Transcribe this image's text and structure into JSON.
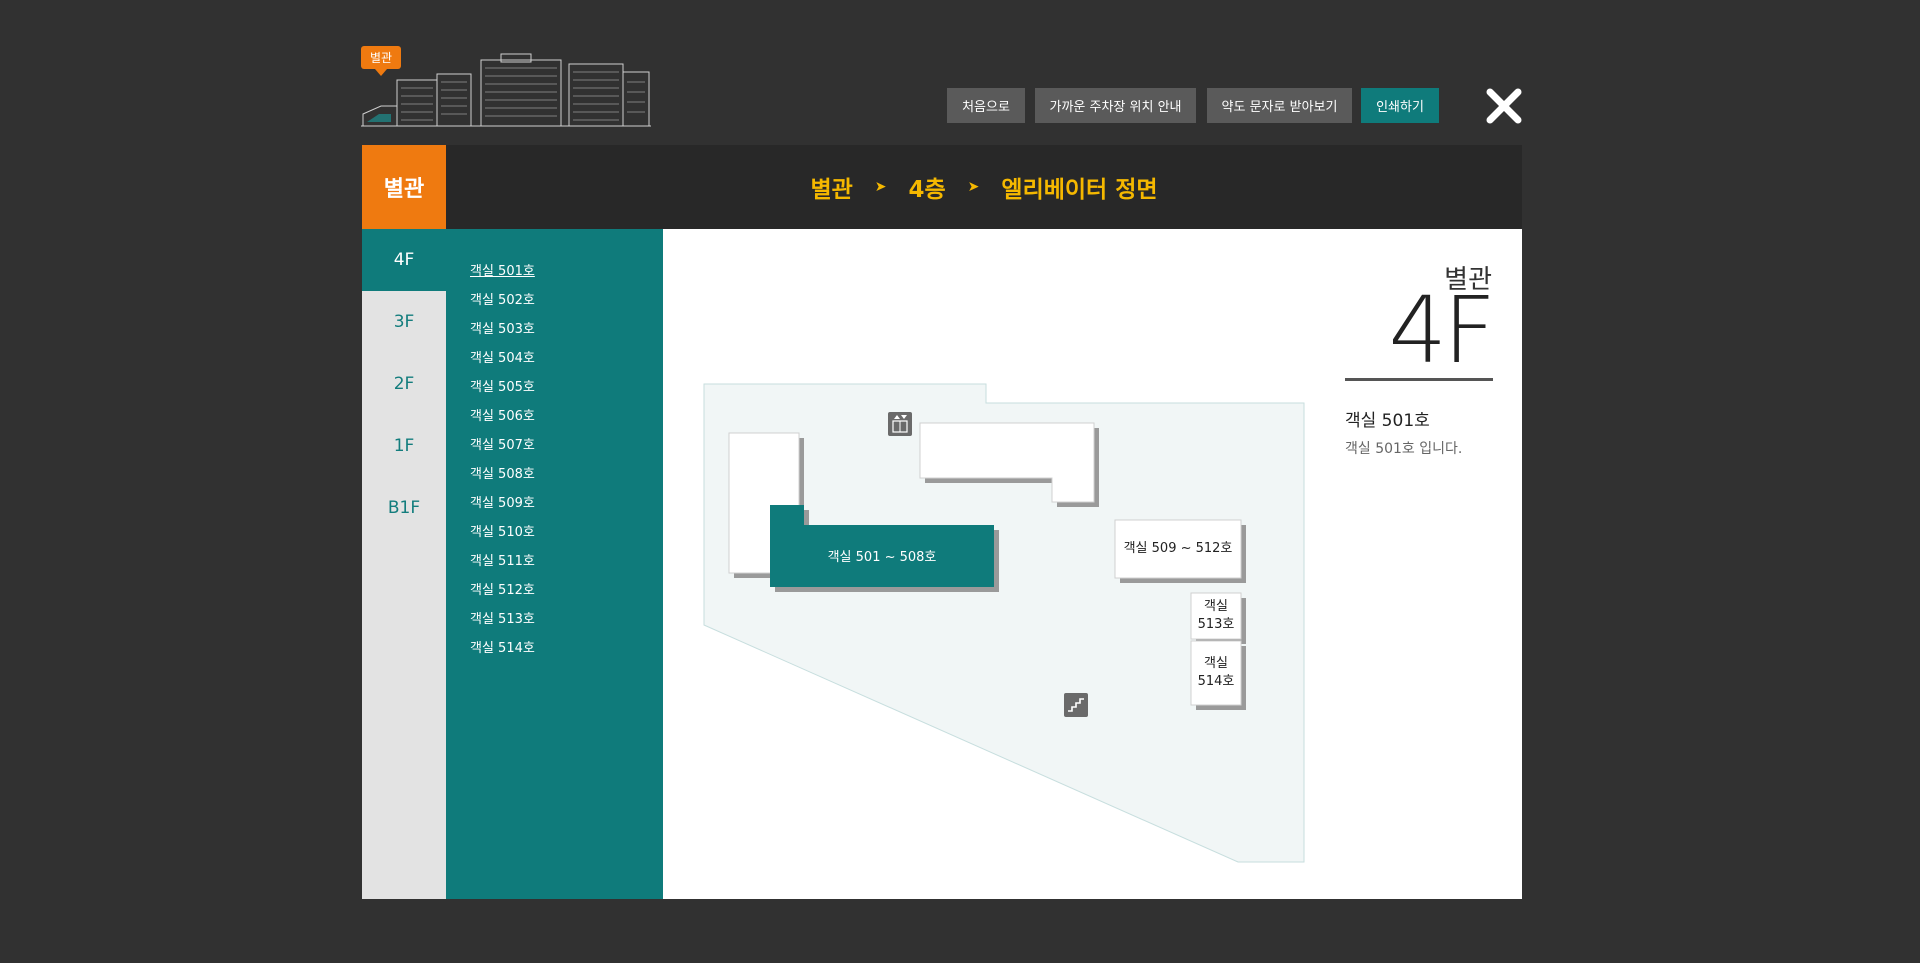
{
  "header": {
    "building_badge": "별관",
    "buttons": {
      "home": "처음으로",
      "parking": "가까운 주차장 위치 안내",
      "sms": "약도 문자로 받아보기",
      "print": "인쇄하기"
    }
  },
  "panel": {
    "building_tab": "별관",
    "breadcrumb": [
      "별관",
      "4층",
      "엘리베이터 정면"
    ],
    "floors": [
      "4F",
      "3F",
      "2F",
      "1F",
      "B1F"
    ],
    "active_floor": "4F",
    "rooms": [
      "객실 501호",
      "객실 502호",
      "객실 503호",
      "객실 504호",
      "객실 505호",
      "객실 506호",
      "객실 507호",
      "객실 508호",
      "객실 509호",
      "객실 510호",
      "객실 511호",
      "객실 512호",
      "객실 513호",
      "객실 514호"
    ],
    "active_room": "객실 501호"
  },
  "map": {
    "labels": {
      "rooms_501_508": "객실 501 ~ 508호",
      "rooms_509_512": "객실 509 ~ 512호",
      "room_513_line1": "객실",
      "room_513_line2": "513호",
      "room_514_line1": "객실",
      "room_514_line2": "514호"
    },
    "icons": [
      "elevator-icon",
      "stairs-icon"
    ]
  },
  "info": {
    "building": "별관",
    "floor": "4F",
    "title": "객실 501호",
    "description": "객실 501호 입니다."
  },
  "colors": {
    "background": "#313131",
    "accent_orange": "#ef7a10",
    "accent_teal": "#0f7b7b",
    "breadcrumb_yellow": "#f5b800"
  }
}
